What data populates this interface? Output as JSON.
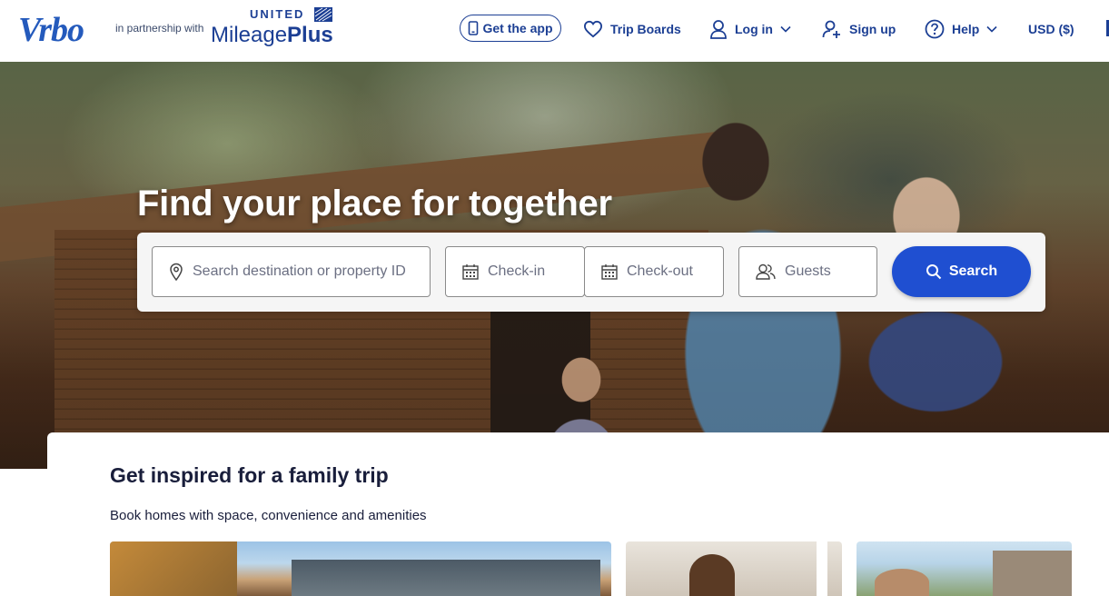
{
  "header": {
    "brand": "Vrbo",
    "partner_text": "in partnership with",
    "partner_brand_top": "UNITED",
    "partner_brand_main": "Mileage",
    "partner_brand_plus": "Plus",
    "nav": {
      "get_app": "Get the app",
      "trip_boards": "Trip Boards",
      "log_in": "Log in",
      "sign_up": "Sign up",
      "help": "Help",
      "currency": "USD ($)"
    }
  },
  "hero": {
    "title": "Find your place for together",
    "search": {
      "destination_placeholder": "Search destination or property ID",
      "checkin_placeholder": "Check-in",
      "checkout_placeholder": "Check-out",
      "guests_placeholder": "Guests",
      "button_label": "Search"
    }
  },
  "section": {
    "title": "Get inspired for a family trip",
    "subtitle": "Book homes with space, convenience and amenities"
  },
  "colors": {
    "brand_blue": "#245abc",
    "nav_blue": "#1c3f94",
    "search_button": "#1f4fd1"
  }
}
